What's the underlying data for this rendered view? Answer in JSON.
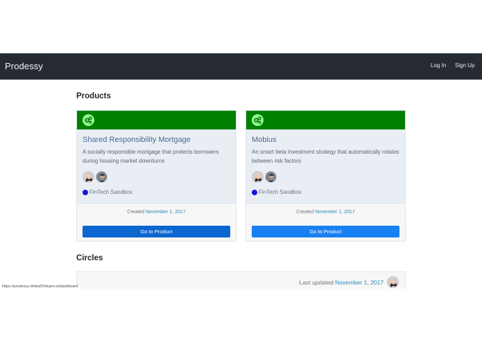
{
  "navbar": {
    "brand": "Prodessy",
    "login_label": "Log In",
    "signup_label": "Sign Up",
    "background": "#262b33"
  },
  "sections": {
    "products_title": "Products",
    "circles_title": "Circles"
  },
  "products": [
    {
      "title": "Shared Responsibility Mortgage",
      "description": "A socially responsible mortgage that protects borrowers during housing market downturns",
      "sandbox": "FinTech Sandbox",
      "created_label": "Created",
      "created_date": "November 1, 2017",
      "button_label": "Go to Product",
      "icon": "gears-icon"
    },
    {
      "title": "Mobius",
      "description": "An smart beta investment strategy that automatically rotates between risk factors",
      "sandbox": "FinTech Sandbox",
      "created_label": "Created",
      "created_date": "November 1, 2017",
      "button_label": "Go to Product",
      "icon": "gears-icon"
    }
  ],
  "circles": {
    "updated_label": "Last updated",
    "updated_date": "November 1, 2017"
  },
  "status_bar": {
    "url": "https://prodessy-dmbaf2r5kqen.io/dashboard"
  },
  "colors": {
    "card_header": "#008000",
    "card_body": "#e9eef5",
    "link": "#2d89b5",
    "button_primary": "#0c66d0",
    "sandbox_dot": "#1515d8"
  }
}
